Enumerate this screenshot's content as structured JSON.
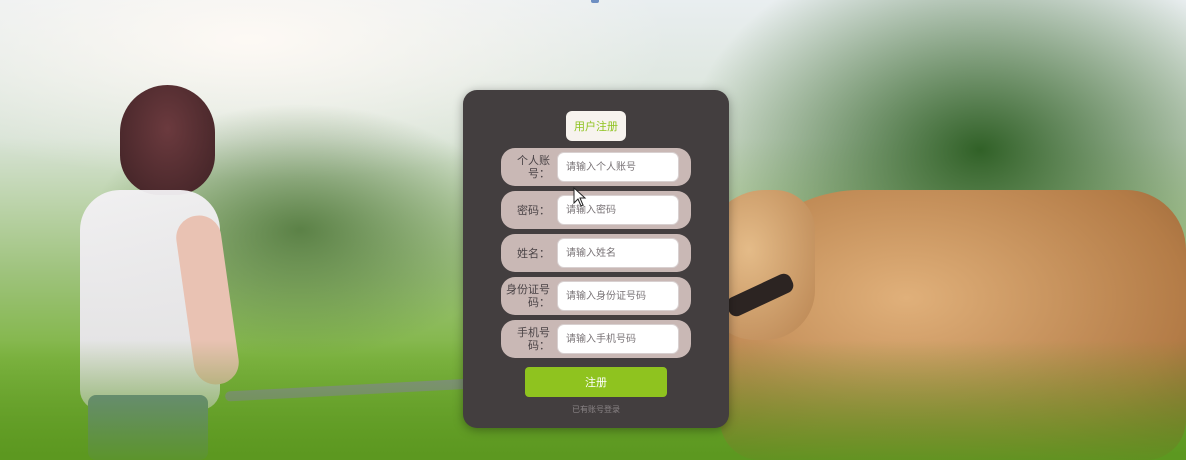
{
  "form": {
    "title": "用户注册",
    "fields": [
      {
        "label": "个人账号：",
        "placeholder": "请输入个人账号"
      },
      {
        "label": "密码：",
        "placeholder": "请输入密码"
      },
      {
        "label": "姓名：",
        "placeholder": "请输入姓名"
      },
      {
        "label": "身份证号码：",
        "placeholder": "请输入身份证号码"
      },
      {
        "label": "手机号码：",
        "placeholder": "请输入手机号码"
      }
    ],
    "submit_label": "注册",
    "login_link": "已有账号登录"
  },
  "icons": {
    "cursor": "mouse-pointer-icon"
  },
  "colors": {
    "panel_bg": "#433e3f",
    "accent": "#8fc31f",
    "row_bg": "#c9b8b5"
  }
}
